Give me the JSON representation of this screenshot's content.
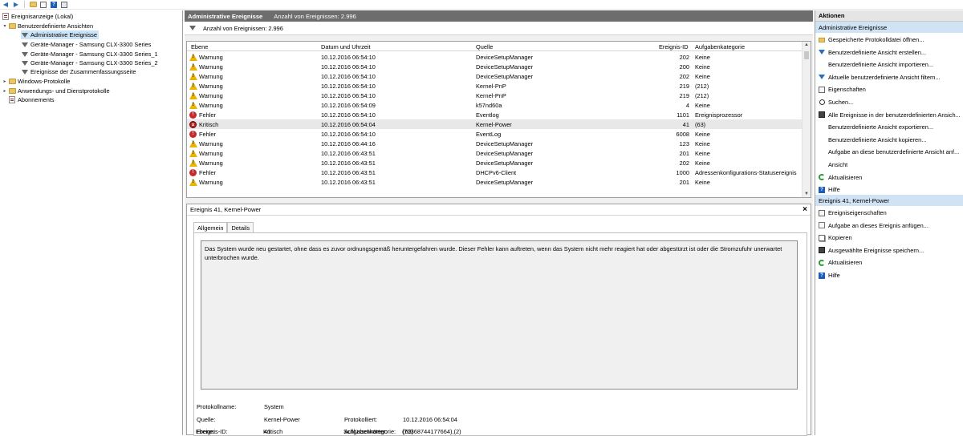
{
  "toolbar": {
    "buttons": [
      "back-icon",
      "forward-icon",
      "up-icon",
      "properties-icon",
      "help-icon",
      "view-icon"
    ]
  },
  "tree": {
    "root": "Ereignisanzeige (Lokal)",
    "custom_views": "Benutzerdefinierte Ansichten",
    "admin_events": "Administrative Ereignisse",
    "gm1": "Geräte-Manager - Samsung CLX-3300 Series",
    "gm2": "Geräte-Manager - Samsung CLX-3300 Series_1",
    "gm3": "Geräte-Manager - Samsung CLX-3300 Series_2",
    "summary": "Ereignisse der Zusammenfassungsseite",
    "windows_logs": "Windows-Protokolle",
    "app_logs": "Anwendungs- und Dienstprotokolle",
    "subscriptions": "Abonnements"
  },
  "center": {
    "title": "Administrative Ereignisse",
    "count_header": "Anzahl von Ereignissen: 2.996",
    "filter_text": "Anzahl von Ereignissen: 2.996",
    "columns": {
      "level": "Ebene",
      "date": "Datum und Uhrzeit",
      "source": "Quelle",
      "id": "Ereignis-ID",
      "category": "Aufgabenkategorie"
    },
    "rows": [
      {
        "type": "warn",
        "level": "Warnung",
        "date": "10.12.2016 06:54:10",
        "source": "DeviceSetupManager",
        "id": "202",
        "category": "Keine"
      },
      {
        "type": "warn",
        "level": "Warnung",
        "date": "10.12.2016 06:54:10",
        "source": "DeviceSetupManager",
        "id": "200",
        "category": "Keine"
      },
      {
        "type": "warn",
        "level": "Warnung",
        "date": "10.12.2016 06:54:10",
        "source": "DeviceSetupManager",
        "id": "202",
        "category": "Keine"
      },
      {
        "type": "warn",
        "level": "Warnung",
        "date": "10.12.2016 06:54:10",
        "source": "Kernel-PnP",
        "id": "219",
        "category": "(212)"
      },
      {
        "type": "warn",
        "level": "Warnung",
        "date": "10.12.2016 06:54:10",
        "source": "Kernel-PnP",
        "id": "219",
        "category": "(212)"
      },
      {
        "type": "warn",
        "level": "Warnung",
        "date": "10.12.2016 06:54:09",
        "source": "k57nd60a",
        "id": "4",
        "category": "Keine"
      },
      {
        "type": "err",
        "level": "Fehler",
        "date": "10.12.2016 06:54:10",
        "source": "Eventlog",
        "id": "1101",
        "category": "Ereignisprozessor"
      },
      {
        "type": "crit",
        "level": "Kritisch",
        "date": "10.12.2016 06:54:04",
        "source": "Kernel-Power",
        "id": "41",
        "category": "(63)"
      },
      {
        "type": "err",
        "level": "Fehler",
        "date": "10.12.2016 06:54:10",
        "source": "EventLog",
        "id": "6008",
        "category": "Keine"
      },
      {
        "type": "warn",
        "level": "Warnung",
        "date": "10.12.2016 06:44:16",
        "source": "DeviceSetupManager",
        "id": "123",
        "category": "Keine"
      },
      {
        "type": "warn",
        "level": "Warnung",
        "date": "10.12.2016 06:43:51",
        "source": "DeviceSetupManager",
        "id": "201",
        "category": "Keine"
      },
      {
        "type": "warn",
        "level": "Warnung",
        "date": "10.12.2016 06:43:51",
        "source": "DeviceSetupManager",
        "id": "202",
        "category": "Keine"
      },
      {
        "type": "err",
        "level": "Fehler",
        "date": "10.12.2016 06:43:51",
        "source": "DHCPv6-Client",
        "id": "1000",
        "category": "Adressenkonfigurations-Statusereignis"
      },
      {
        "type": "warn",
        "level": "Warnung",
        "date": "10.12.2016 06:43:51",
        "source": "DeviceSetupManager",
        "id": "201",
        "category": "Keine"
      }
    ]
  },
  "detail": {
    "title": "Ereignis 41, Kernel-Power",
    "close": "×",
    "tab_general": "Allgemein",
    "tab_details": "Details",
    "message": "Das System wurde neu gestartet, ohne dass es zuvor ordnungsgemäß heruntergefahren wurde. Dieser Fehler kann auftreten, wenn das System nicht mehr reagiert hat oder abgestürzt ist oder die Stromzufuhr unerwartet unterbrochen wurde.",
    "log_name_label": "Protokollname:",
    "log_name": "System",
    "source_label": "Quelle:",
    "source": "Kernel-Power",
    "logged_label": "Protokolliert:",
    "logged": "10.12.2016 06:54:04",
    "event_id_label": "Ereignis-ID:",
    "event_id": "41",
    "task_label": "Aufgabenkategorie:",
    "task": "(63)",
    "level_label": "Ebene:",
    "level": "Kritisch",
    "keywords_label": "Schlüsselwörter:",
    "keywords": "(70368744177664),(2)"
  },
  "actions": {
    "header": "Aktionen",
    "section1": "Administrative Ereignisse",
    "items1": [
      {
        "icon": "folder",
        "label": "Gespeicherte Protokolldatei öffnen..."
      },
      {
        "icon": "funnel",
        "label": "Benutzerdefinierte Ansicht erstellen..."
      },
      {
        "icon": "none",
        "label": "Benutzerdefinierte Ansicht importieren..."
      },
      {
        "icon": "funnel",
        "label": "Aktuelle benutzerdefinierte Ansicht filtern..."
      },
      {
        "icon": "props",
        "label": "Eigenschaften"
      },
      {
        "icon": "search",
        "label": "Suchen..."
      },
      {
        "icon": "save",
        "label": "Alle Ereignisse in der benutzerdefinierten Ansich..."
      },
      {
        "icon": "none",
        "label": "Benutzerdefinierte Ansicht exportieren..."
      },
      {
        "icon": "none",
        "label": "Benutzerdefinierte Ansicht kopieren..."
      },
      {
        "icon": "none",
        "label": "Aufgabe an diese benutzerdefinierte Ansicht anf..."
      },
      {
        "icon": "none",
        "label": "Ansicht"
      },
      {
        "icon": "refresh",
        "label": "Aktualisieren"
      },
      {
        "icon": "help",
        "label": "Hilfe"
      }
    ],
    "section2": "Ereignis 41, Kernel-Power",
    "items2": [
      {
        "icon": "props",
        "label": "Ereigniseigenschaften"
      },
      {
        "icon": "task",
        "label": "Aufgabe an dieses Ereignis anfügen..."
      },
      {
        "icon": "copy",
        "label": "Kopieren"
      },
      {
        "icon": "save",
        "label": "Ausgewählte Ereignisse speichern..."
      },
      {
        "icon": "refresh",
        "label": "Aktualisieren"
      },
      {
        "icon": "help",
        "label": "Hilfe"
      }
    ]
  }
}
